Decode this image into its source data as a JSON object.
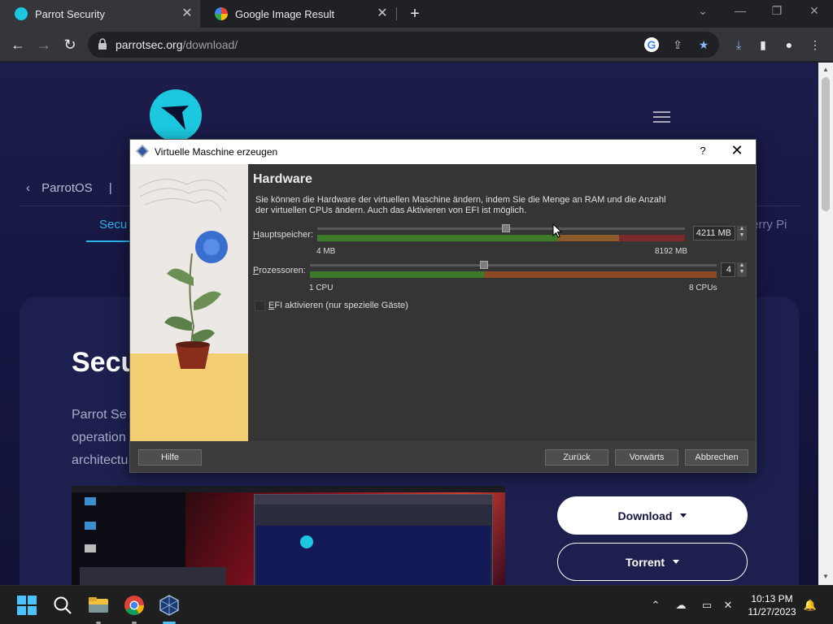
{
  "browser": {
    "tabs": [
      {
        "title": "Parrot Security",
        "favicon": "parrot-logo-icon"
      },
      {
        "title": "Google Image Result",
        "favicon": "google-icon"
      }
    ],
    "new_tab": "+",
    "url_host": "parrotsec.org",
    "url_path": "/download/"
  },
  "site": {
    "breadcrumb": "ParrotOS",
    "breadcrumb_sep": "|",
    "tab_active": "Secu",
    "tab_right": "erry Pi",
    "hero_title": "Secu",
    "hero_lines": [
      "Parrot Se",
      "operation",
      "architectu"
    ],
    "download_label": "Download",
    "torrent_label": "Torrent",
    "accent_color": "#2ab4e9"
  },
  "dialog": {
    "title": "Virtuelle Maschine erzeugen",
    "help_glyph": "?",
    "close_glyph": "✕",
    "heading": "Hardware",
    "description": "Sie können die Hardware der virtuellen Maschine ändern, indem Sie die Menge an RAM und die Anzahl der virtuellen CPUs ändern. Auch das Aktivieren von EFI ist möglich.",
    "memory": {
      "label_prefix": "H",
      "label_rest": "auptspeicher:",
      "value": "4211 MB",
      "min_label": "4 MB",
      "max_label": "8192 MB",
      "value_mb": 4211,
      "max_mb": 8192
    },
    "cpu": {
      "label_prefix": "P",
      "label_rest": "rozessoren:",
      "value": "4",
      "min_label": "1 CPU",
      "max_label": "8 CPUs",
      "count": 4,
      "max": 8
    },
    "efi": {
      "label_prefix": "E",
      "label_rest": "FI aktivieren (nur spezielle Gäste)",
      "checked": false
    },
    "buttons": {
      "help": "Hilfe",
      "back": "Zurück",
      "next": "Vorwärts",
      "cancel": "Abbrechen"
    }
  },
  "taskbar": {
    "time": "10:13 PM",
    "date": "11/27/2023"
  }
}
